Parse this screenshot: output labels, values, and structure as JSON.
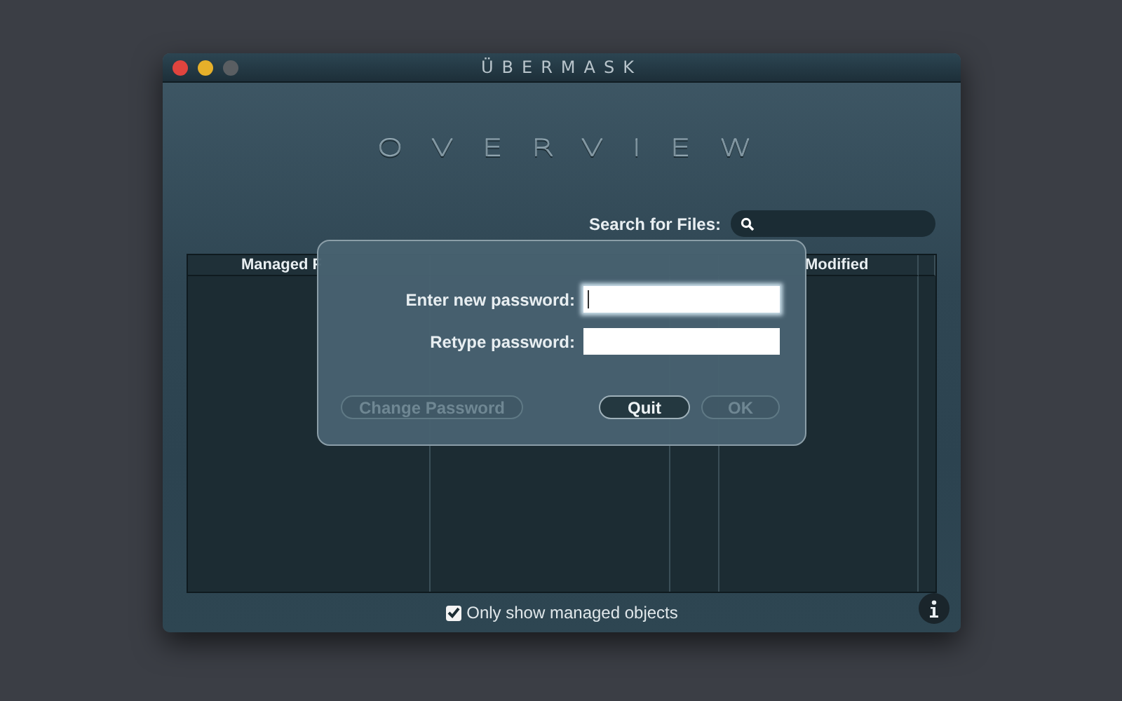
{
  "window": {
    "title": "ÜBERMASK",
    "traffic_lights": [
      {
        "color": "#e0443e"
      },
      {
        "color": "#e6b02a"
      },
      {
        "color": "#5a5e62"
      }
    ]
  },
  "heading": "OVERVIEW",
  "search": {
    "label": "Search for Files:"
  },
  "table": {
    "columns": [
      {
        "label": "Managed F"
      },
      {
        "label": "Modified"
      }
    ]
  },
  "dialog": {
    "fields": [
      {
        "label": "Enter new password:",
        "focused": true
      },
      {
        "label": "Retype password:",
        "focused": false
      }
    ],
    "buttons": [
      {
        "label": "Change Password",
        "disabled": true,
        "kind": "wide"
      },
      {
        "label": "Quit",
        "disabled": false,
        "kind": "normal"
      },
      {
        "label": "OK",
        "disabled": true,
        "kind": "normal"
      }
    ]
  },
  "footer": {
    "checkbox": {
      "label": "Only show managed objects",
      "checked": true
    }
  }
}
